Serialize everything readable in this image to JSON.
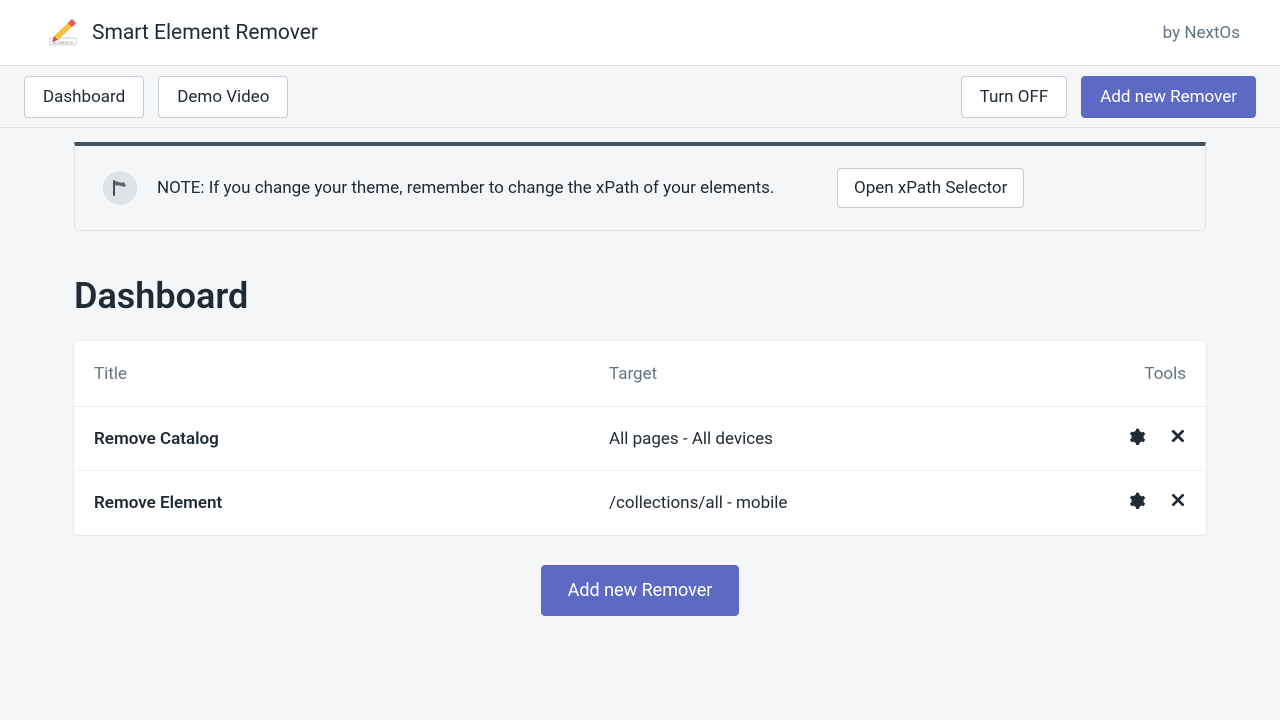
{
  "header": {
    "app_title": "Smart Element Remover",
    "by_text": "by NextOs"
  },
  "toolbar": {
    "dashboard_label": "Dashboard",
    "demo_video_label": "Demo Video",
    "turn_off_label": "Turn OFF",
    "add_new_label": "Add new Remover"
  },
  "notice": {
    "text": "NOTE: If you change your theme, remember to change the xPath of your elements.",
    "button_label": "Open xPath Selector"
  },
  "page": {
    "title": "Dashboard"
  },
  "table": {
    "headers": {
      "title": "Title",
      "target": "Target",
      "tools": "Tools"
    },
    "rows": [
      {
        "title": "Remove Catalog",
        "target": "All pages - All devices"
      },
      {
        "title": "Remove Element",
        "target": "/collections/all - mobile"
      }
    ]
  },
  "bottom": {
    "add_new_label": "Add new Remover"
  }
}
